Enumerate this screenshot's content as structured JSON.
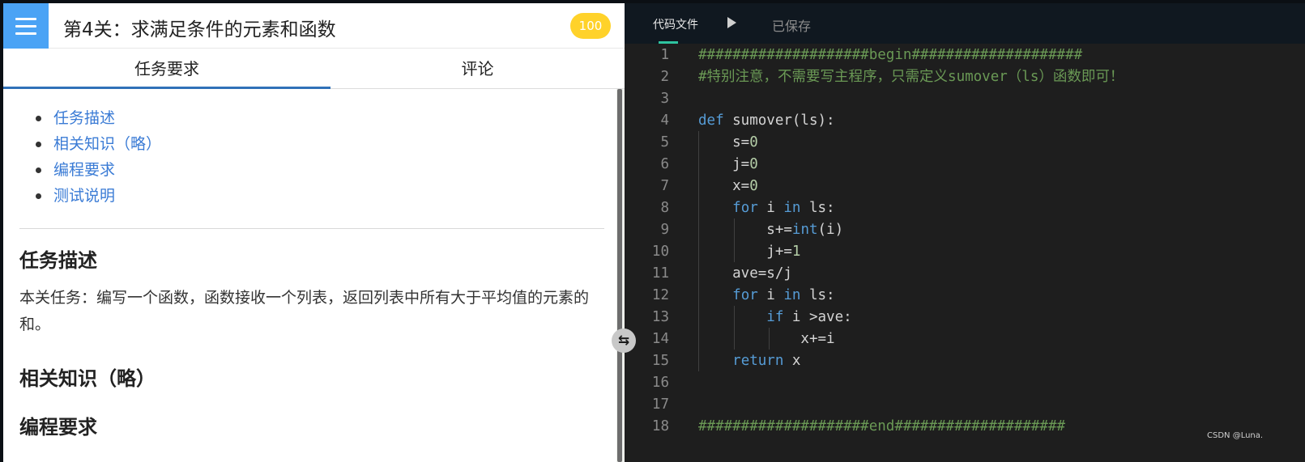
{
  "header": {
    "title": "第4关：求满足条件的元素和函数",
    "score": "100",
    "menu_icon": "hamburger-menu-icon"
  },
  "tabs": [
    {
      "label": "任务要求",
      "active": true
    },
    {
      "label": "评论",
      "active": false
    }
  ],
  "toc": [
    "任务描述",
    "相关知识（略）",
    "编程要求",
    "测试说明"
  ],
  "sections": {
    "desc_heading": "任务描述",
    "desc_text": "本关任务：编写一个函数，函数接收一个列表，返回列表中所有大于平均值的元素的和。",
    "knowledge_heading": "相关知识（略）",
    "program_heading": "编程要求"
  },
  "editor": {
    "file_tab": "代码文件",
    "saved_status": "已保存",
    "run_icon": "play-icon",
    "swap_icon": "swap-arrows-icon",
    "lines": [
      {
        "n": "1",
        "text": "####################begin####################"
      },
      {
        "n": "2",
        "text": "#特别注意，不需要写主程序，只需定义sumover（ls）函数即可！"
      },
      {
        "n": "3",
        "text": ""
      },
      {
        "n": "4",
        "text": "def sumover(ls):"
      },
      {
        "n": "5",
        "text": "    s=0"
      },
      {
        "n": "6",
        "text": "    j=0"
      },
      {
        "n": "7",
        "text": "    x=0"
      },
      {
        "n": "8",
        "text": "    for i in ls:"
      },
      {
        "n": "9",
        "text": "        s+=int(i)"
      },
      {
        "n": "10",
        "text": "        j+=1"
      },
      {
        "n": "11",
        "text": "    ave=s/j"
      },
      {
        "n": "12",
        "text": "    for i in ls:"
      },
      {
        "n": "13",
        "text": "        if i >ave:"
      },
      {
        "n": "14",
        "text": "            x+=i"
      },
      {
        "n": "15",
        "text": "    return x"
      },
      {
        "n": "16",
        "text": ""
      },
      {
        "n": "17",
        "text": ""
      },
      {
        "n": "18",
        "text": "####################end####################"
      }
    ]
  },
  "watermark": "CSDN @Luna.",
  "colors": {
    "accent_blue": "#4aa3f5",
    "tab_underline": "#3071b8",
    "score_badge": "#ffd22a",
    "editor_bg": "#1e1e1e",
    "comment": "#6a9955",
    "keyword": "#569cd6",
    "number": "#b5cea8"
  }
}
